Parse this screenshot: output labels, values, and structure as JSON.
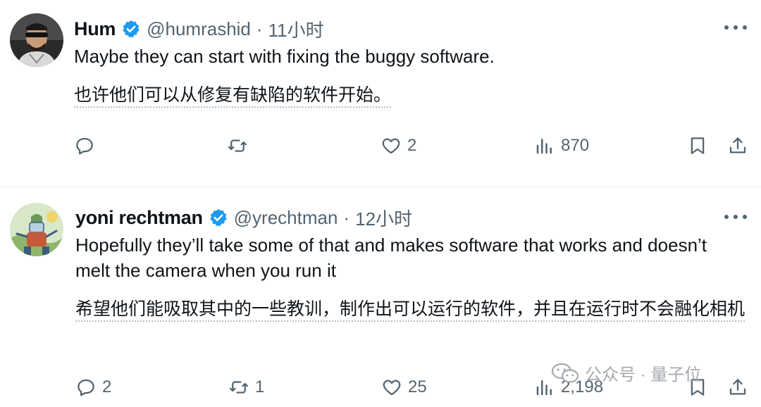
{
  "tweets": [
    {
      "name": "Hum",
      "handle": "@humrashid",
      "separator": "·",
      "time": "11小时",
      "text": "Maybe they can start with fixing the buggy software.",
      "translation": "也许他们可以从修复有缺陷的软件开始。",
      "replies": "",
      "retweets": "",
      "likes": "2",
      "views": "870"
    },
    {
      "name": "yoni rechtman",
      "handle": "@yrechtman",
      "separator": "·",
      "time": "12小时",
      "text": "Hopefully they’ll take some of that and makes software that works and doesn’t melt the camera when you run it",
      "translation": "希望他们能吸取其中的一些教训，制作出可以运行的软件，并且在运行时不会融化相机",
      "replies": "2",
      "retweets": "1",
      "likes": "25",
      "views": "2,198"
    }
  ],
  "watermark": {
    "text": "公众号 · 量子位",
    "icon": "wechat-icon"
  },
  "colors": {
    "verified": "#1d9bf0",
    "muted": "#536471",
    "text": "#0f1419",
    "divider": "#e9ecee"
  }
}
